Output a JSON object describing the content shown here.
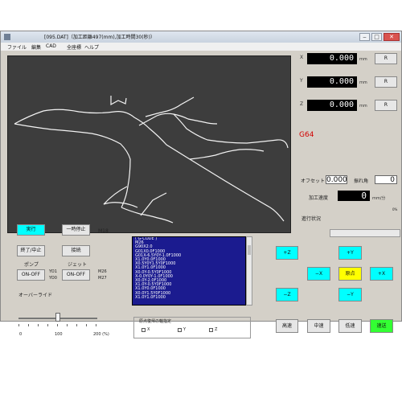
{
  "window": {
    "title": "[095.DAT]（加工距離497(mm),加工時間30(秒)）",
    "controls": {
      "minimize": "‒",
      "maximize": "□",
      "close": "✕"
    }
  },
  "menu": [
    "ファイル",
    "編集",
    "CAD",
    "全座標",
    "ヘルプ"
  ],
  "coordinates": {
    "unit": "mm",
    "reset_label": "R",
    "axes": [
      {
        "axis": "X",
        "value": "0.000"
      },
      {
        "axis": "Y",
        "value": "0.000"
      },
      {
        "axis": "Z",
        "value": "0.000"
      }
    ]
  },
  "mode": "G64",
  "offset": {
    "label": "オフセット",
    "value": "0.000"
  },
  "rotation": {
    "label": "振れ角",
    "value": "0"
  },
  "feed": {
    "label": "加工速度",
    "value": "0",
    "unit": "mm/分"
  },
  "progress": {
    "label": "進行状況",
    "value": 0,
    "scale_small": "0%"
  },
  "buttons": {
    "run": "実行",
    "pause": "一時停止",
    "stop": "終了/中止",
    "pump_label": "ポンプ",
    "pump_toggle": "ON-OFF",
    "jet_label": "ジェット",
    "jet_toggle": "ON-OFF",
    "switch": "接続",
    "m_label1": "M18",
    "m_label2": "M26",
    "m_label3": "M27",
    "sub_label1": "YO1",
    "sub_label2": "YO0"
  },
  "override": {
    "label": "オーバーライド",
    "value": 100,
    "min_label": "0",
    "mid_label": "100",
    "max_label": "200 (%)"
  },
  "gcode_lines": [
    "( G-CODE )",
    "M26",
    "G90X2.0",
    "G01X0.0F1000",
    "G01X-6.5Y0Y-1.0F1000",
    "X1.0Y0.0F1000",
    "X0.5Y0Y1.5Y0F1000",
    "X1.0Y1.0F1000",
    "X0.0Y-0.5Y0F1000",
    "X-0.0Y0Y-1.0F1000",
    "X0.0Y-2.0F1000",
    "X1.0Y-0.5Y0F1000",
    "X1.0Y0.0F1000",
    "X0.0Y1.5Y0F1000",
    "X1.0Y1.0F1000"
  ],
  "origin_group": {
    "label": "原点復帰の軸指定",
    "axes": [
      "X",
      "Y",
      "Z"
    ]
  },
  "jog": {
    "plus_z": "+Z",
    "minus_z": "−Z",
    "plus_y": "+Y",
    "minus_y": "−Y",
    "plus_x": "+X",
    "minus_x": "−X",
    "origin": "原点"
  },
  "speed": [
    "高速",
    "中速",
    "低速",
    "速送"
  ]
}
